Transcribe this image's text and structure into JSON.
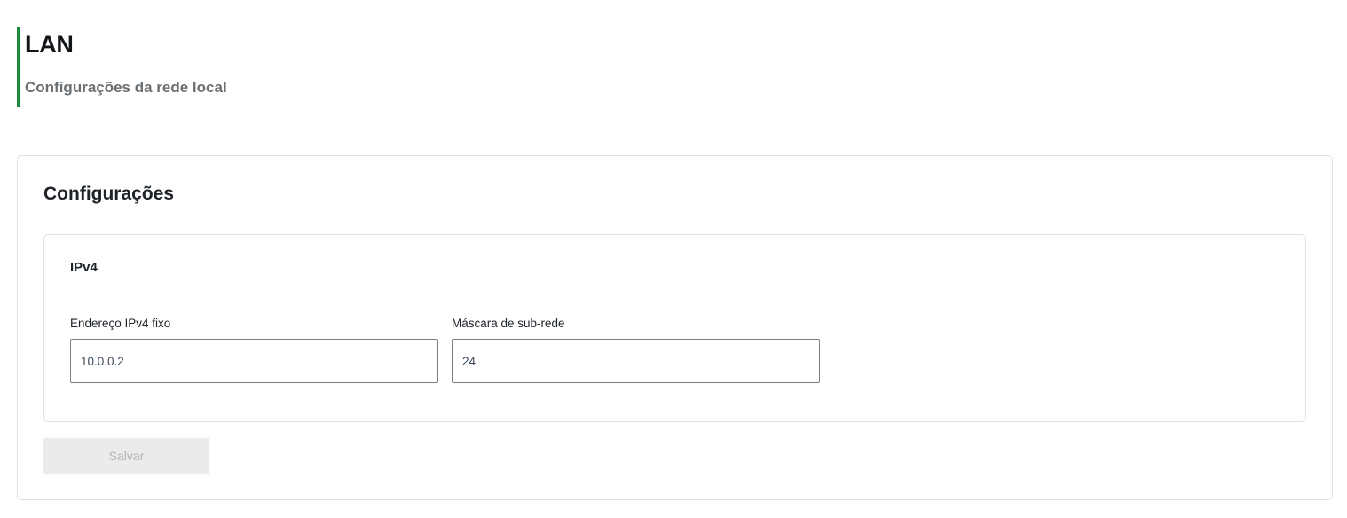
{
  "header": {
    "title": "LAN",
    "subtitle": "Configurações da rede local"
  },
  "card": {
    "title": "Configurações",
    "section": {
      "title": "IPv4",
      "fields": [
        {
          "label": "Endereço IPv4 fixo",
          "value": "10.0.0.2"
        },
        {
          "label": "Máscara de sub-rede",
          "value": "24"
        }
      ]
    },
    "save_label": "Salvar"
  },
  "colors": {
    "accent": "#1e8a3c",
    "disabled_button_bg": "#ebebeb",
    "disabled_button_text": "#b4b4b4"
  }
}
